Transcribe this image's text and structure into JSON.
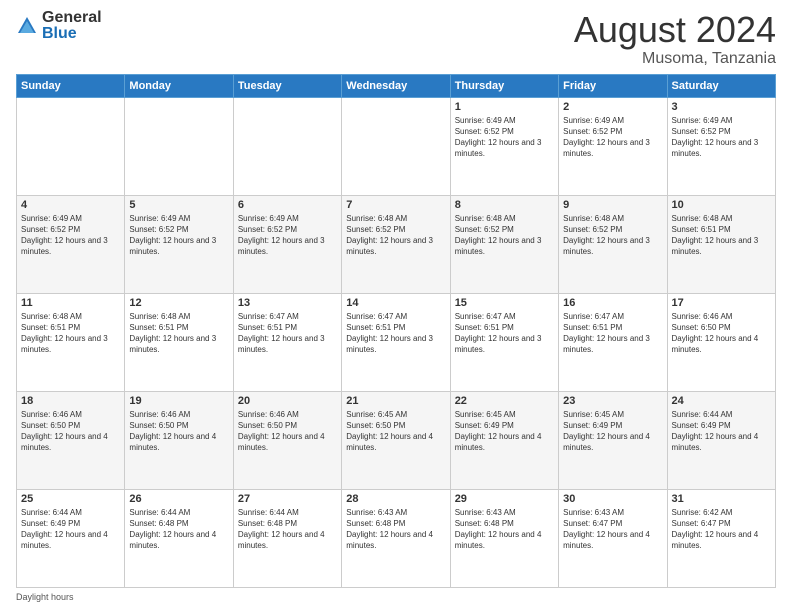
{
  "logo": {
    "general": "General",
    "blue": "Blue"
  },
  "title": {
    "month_year": "August 2024",
    "location": "Musoma, Tanzania"
  },
  "days_of_week": [
    "Sunday",
    "Monday",
    "Tuesday",
    "Wednesday",
    "Thursday",
    "Friday",
    "Saturday"
  ],
  "footer": {
    "daylight_label": "Daylight hours"
  },
  "weeks": [
    [
      {
        "day": "",
        "sunrise": "",
        "sunset": "",
        "daylight": ""
      },
      {
        "day": "",
        "sunrise": "",
        "sunset": "",
        "daylight": ""
      },
      {
        "day": "",
        "sunrise": "",
        "sunset": "",
        "daylight": ""
      },
      {
        "day": "",
        "sunrise": "",
        "sunset": "",
        "daylight": ""
      },
      {
        "day": "1",
        "sunrise": "Sunrise: 6:49 AM",
        "sunset": "Sunset: 6:52 PM",
        "daylight": "Daylight: 12 hours and 3 minutes."
      },
      {
        "day": "2",
        "sunrise": "Sunrise: 6:49 AM",
        "sunset": "Sunset: 6:52 PM",
        "daylight": "Daylight: 12 hours and 3 minutes."
      },
      {
        "day": "3",
        "sunrise": "Sunrise: 6:49 AM",
        "sunset": "Sunset: 6:52 PM",
        "daylight": "Daylight: 12 hours and 3 minutes."
      }
    ],
    [
      {
        "day": "4",
        "sunrise": "Sunrise: 6:49 AM",
        "sunset": "Sunset: 6:52 PM",
        "daylight": "Daylight: 12 hours and 3 minutes."
      },
      {
        "day": "5",
        "sunrise": "Sunrise: 6:49 AM",
        "sunset": "Sunset: 6:52 PM",
        "daylight": "Daylight: 12 hours and 3 minutes."
      },
      {
        "day": "6",
        "sunrise": "Sunrise: 6:49 AM",
        "sunset": "Sunset: 6:52 PM",
        "daylight": "Daylight: 12 hours and 3 minutes."
      },
      {
        "day": "7",
        "sunrise": "Sunrise: 6:48 AM",
        "sunset": "Sunset: 6:52 PM",
        "daylight": "Daylight: 12 hours and 3 minutes."
      },
      {
        "day": "8",
        "sunrise": "Sunrise: 6:48 AM",
        "sunset": "Sunset: 6:52 PM",
        "daylight": "Daylight: 12 hours and 3 minutes."
      },
      {
        "day": "9",
        "sunrise": "Sunrise: 6:48 AM",
        "sunset": "Sunset: 6:52 PM",
        "daylight": "Daylight: 12 hours and 3 minutes."
      },
      {
        "day": "10",
        "sunrise": "Sunrise: 6:48 AM",
        "sunset": "Sunset: 6:51 PM",
        "daylight": "Daylight: 12 hours and 3 minutes."
      }
    ],
    [
      {
        "day": "11",
        "sunrise": "Sunrise: 6:48 AM",
        "sunset": "Sunset: 6:51 PM",
        "daylight": "Daylight: 12 hours and 3 minutes."
      },
      {
        "day": "12",
        "sunrise": "Sunrise: 6:48 AM",
        "sunset": "Sunset: 6:51 PM",
        "daylight": "Daylight: 12 hours and 3 minutes."
      },
      {
        "day": "13",
        "sunrise": "Sunrise: 6:47 AM",
        "sunset": "Sunset: 6:51 PM",
        "daylight": "Daylight: 12 hours and 3 minutes."
      },
      {
        "day": "14",
        "sunrise": "Sunrise: 6:47 AM",
        "sunset": "Sunset: 6:51 PM",
        "daylight": "Daylight: 12 hours and 3 minutes."
      },
      {
        "day": "15",
        "sunrise": "Sunrise: 6:47 AM",
        "sunset": "Sunset: 6:51 PM",
        "daylight": "Daylight: 12 hours and 3 minutes."
      },
      {
        "day": "16",
        "sunrise": "Sunrise: 6:47 AM",
        "sunset": "Sunset: 6:51 PM",
        "daylight": "Daylight: 12 hours and 3 minutes."
      },
      {
        "day": "17",
        "sunrise": "Sunrise: 6:46 AM",
        "sunset": "Sunset: 6:50 PM",
        "daylight": "Daylight: 12 hours and 4 minutes."
      }
    ],
    [
      {
        "day": "18",
        "sunrise": "Sunrise: 6:46 AM",
        "sunset": "Sunset: 6:50 PM",
        "daylight": "Daylight: 12 hours and 4 minutes."
      },
      {
        "day": "19",
        "sunrise": "Sunrise: 6:46 AM",
        "sunset": "Sunset: 6:50 PM",
        "daylight": "Daylight: 12 hours and 4 minutes."
      },
      {
        "day": "20",
        "sunrise": "Sunrise: 6:46 AM",
        "sunset": "Sunset: 6:50 PM",
        "daylight": "Daylight: 12 hours and 4 minutes."
      },
      {
        "day": "21",
        "sunrise": "Sunrise: 6:45 AM",
        "sunset": "Sunset: 6:50 PM",
        "daylight": "Daylight: 12 hours and 4 minutes."
      },
      {
        "day": "22",
        "sunrise": "Sunrise: 6:45 AM",
        "sunset": "Sunset: 6:49 PM",
        "daylight": "Daylight: 12 hours and 4 minutes."
      },
      {
        "day": "23",
        "sunrise": "Sunrise: 6:45 AM",
        "sunset": "Sunset: 6:49 PM",
        "daylight": "Daylight: 12 hours and 4 minutes."
      },
      {
        "day": "24",
        "sunrise": "Sunrise: 6:44 AM",
        "sunset": "Sunset: 6:49 PM",
        "daylight": "Daylight: 12 hours and 4 minutes."
      }
    ],
    [
      {
        "day": "25",
        "sunrise": "Sunrise: 6:44 AM",
        "sunset": "Sunset: 6:49 PM",
        "daylight": "Daylight: 12 hours and 4 minutes."
      },
      {
        "day": "26",
        "sunrise": "Sunrise: 6:44 AM",
        "sunset": "Sunset: 6:48 PM",
        "daylight": "Daylight: 12 hours and 4 minutes."
      },
      {
        "day": "27",
        "sunrise": "Sunrise: 6:44 AM",
        "sunset": "Sunset: 6:48 PM",
        "daylight": "Daylight: 12 hours and 4 minutes."
      },
      {
        "day": "28",
        "sunrise": "Sunrise: 6:43 AM",
        "sunset": "Sunset: 6:48 PM",
        "daylight": "Daylight: 12 hours and 4 minutes."
      },
      {
        "day": "29",
        "sunrise": "Sunrise: 6:43 AM",
        "sunset": "Sunset: 6:48 PM",
        "daylight": "Daylight: 12 hours and 4 minutes."
      },
      {
        "day": "30",
        "sunrise": "Sunrise: 6:43 AM",
        "sunset": "Sunset: 6:47 PM",
        "daylight": "Daylight: 12 hours and 4 minutes."
      },
      {
        "day": "31",
        "sunrise": "Sunrise: 6:42 AM",
        "sunset": "Sunset: 6:47 PM",
        "daylight": "Daylight: 12 hours and 4 minutes."
      }
    ]
  ]
}
